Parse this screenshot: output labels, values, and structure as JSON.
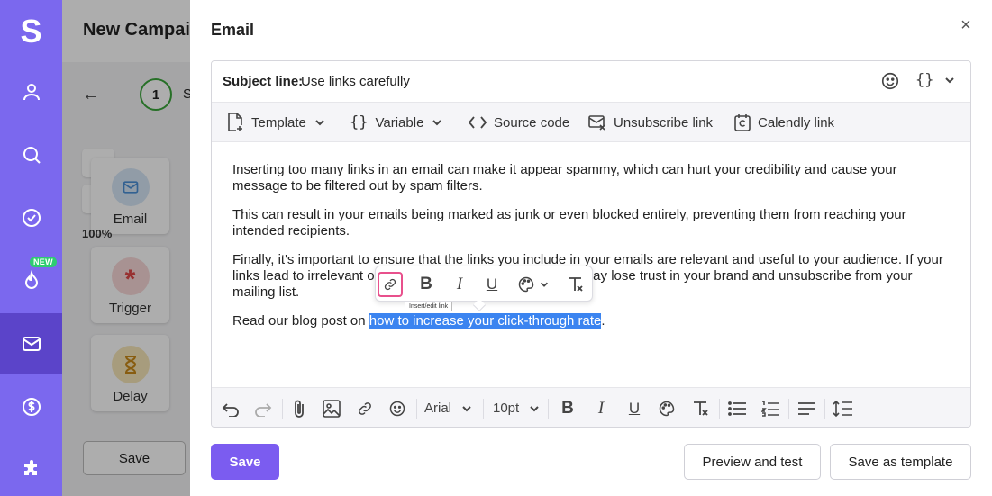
{
  "app": {
    "logo": "S",
    "nav_items": [
      "user-icon",
      "search-icon",
      "check-circle-icon",
      "flame-icon",
      "mail-icon",
      "dollar-icon",
      "puzzle-icon"
    ],
    "new_badge": "NEW"
  },
  "background_page": {
    "title": "New Campaign",
    "step_number": "1",
    "step_label": "S",
    "cards": [
      "Email",
      "Trigger",
      "Delay"
    ],
    "percent": "100%",
    "save_label": "Save"
  },
  "modal": {
    "title": "Email",
    "close": "×"
  },
  "subject": {
    "label": "Subject line:",
    "value": "Use links carefully",
    "var_symbol": "{}"
  },
  "toolbar": {
    "template": "Template",
    "variable": "Variable",
    "source_code": "Source code",
    "unsubscribe": "Unsubscribe link",
    "calendly": "Calendly link"
  },
  "content": {
    "p1": "Inserting too many links in an email can make it appear spammy, which can hurt your credibility and cause your message to be filtered out by spam filters.",
    "p2": "This can result in your emails being marked as junk or even blocked entirely, preventing them from reaching your intended recipients.",
    "p3": "Finally, it's important to ensure that the links you include in your emails are relevant and useful to your audience. If your links lead to irrelevant or low-quality content, your readers may lose trust in your brand and unsubscribe from your mailing list.",
    "p4_prefix": "Read our blog post on ",
    "p4_selected": "how to increase your click-through rate",
    "p4_suffix": "."
  },
  "float_toolbar": {
    "tooltip": "Insert/edit link"
  },
  "footer_toolbar": {
    "font": "Arial",
    "size": "10pt"
  },
  "actions": {
    "save": "Save",
    "preview": "Preview and test",
    "save_template": "Save as template"
  },
  "colors": {
    "nav": "#7b68ee",
    "nav_active": "#5b44c9",
    "primary": "#7b5cf0",
    "selection": "#3b84f0",
    "link_highlight": "#e8508c",
    "badge": "#2ecc71"
  }
}
